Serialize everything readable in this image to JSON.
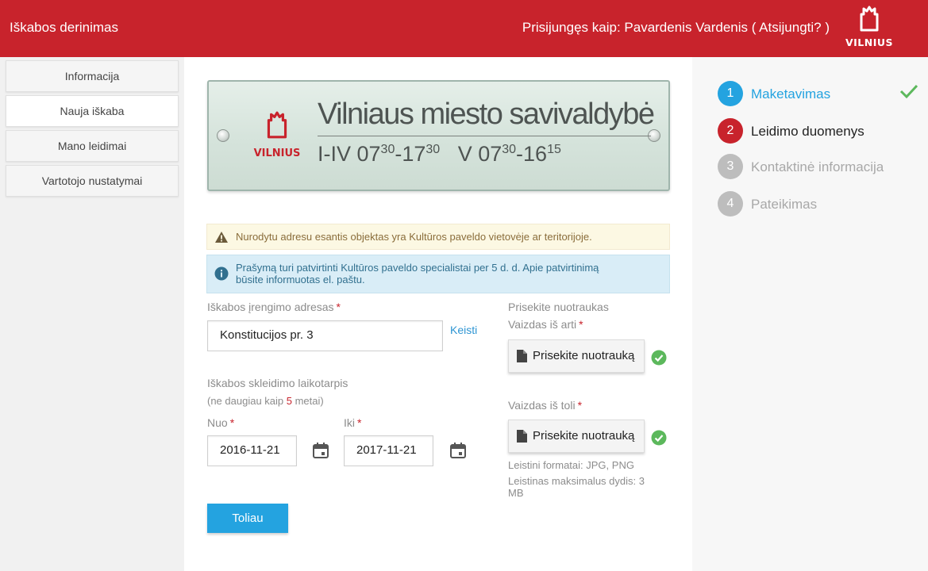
{
  "header": {
    "app_title": "Iškabos derinimas",
    "user_info": "Prisijungęs kaip: Pavardenis Vardenis ( Atsijungti? )",
    "logo_text": "VILNIUS",
    "bg_color": "#c8232c"
  },
  "sidebar": {
    "items": [
      {
        "label": "Informacija"
      },
      {
        "label": "Nauja iškaba"
      },
      {
        "label": "Mano leidimai"
      },
      {
        "label": "Vartotojo nustatymai"
      }
    ]
  },
  "banner": {
    "logo_text": "VILNIUS",
    "title": "Vilniaus miesto savivaldybė",
    "hours_1_days": "I-IV 07",
    "hours_1_open_sup": "30",
    "hours_1_dash": "-17",
    "hours_1_close_sup": "30",
    "hours_2_days": "V 07",
    "hours_2_open_sup": "30",
    "hours_2_dash": "-16",
    "hours_2_close_sup": "15"
  },
  "alerts": {
    "warning": "Nurodytu adresu esantis objektas yra Kultūros paveldo vietovėje ar teritorijoje.",
    "info_line1": "Prašymą turi patvirtinti Kultūros paveldo specialistai per 5 d. d. Apie patvirtinimą",
    "info_line2": "būsite informuotas el. paštu."
  },
  "form": {
    "address_label": "Iškabos įrengimo adresas",
    "address_value": "Konstitucijos pr. 3",
    "change_link": "Keisti",
    "period_label": "Iškabos skleidimo laikotarpis",
    "period_note_prefix": "(ne daugiau kaip ",
    "period_note_num": "5",
    "period_note_suffix": " metai)",
    "from_label": "Nuo",
    "from_value": "2016-11-21",
    "to_label": "Iki",
    "to_value": "2017-11-21",
    "required_mark": "*",
    "next_button": "Toliau"
  },
  "photos": {
    "section_label": "Prisekite nuotraukas",
    "close_label": "Vaizdas iš arti",
    "far_label": "Vaizdas iš toli",
    "attach_button": "Prisekite nuotrauką",
    "formats_note": "Leistini formatai: JPG, PNG",
    "size_note_line1": "Leistinas maksimalus dydis: 3",
    "size_note_line2": "MB"
  },
  "steps": [
    {
      "number": "1",
      "label": "Maketavimas",
      "state": "completed"
    },
    {
      "number": "2",
      "label": "Leidimo duomenys",
      "state": "current"
    },
    {
      "number": "3",
      "label": "Kontaktinė informacija",
      "state": "pending"
    },
    {
      "number": "4",
      "label": "Pateikimas",
      "state": "pending"
    }
  ],
  "colors": {
    "brand_red": "#c8232c",
    "accent_blue": "#24a3e0",
    "success_green": "#5cb85c"
  }
}
